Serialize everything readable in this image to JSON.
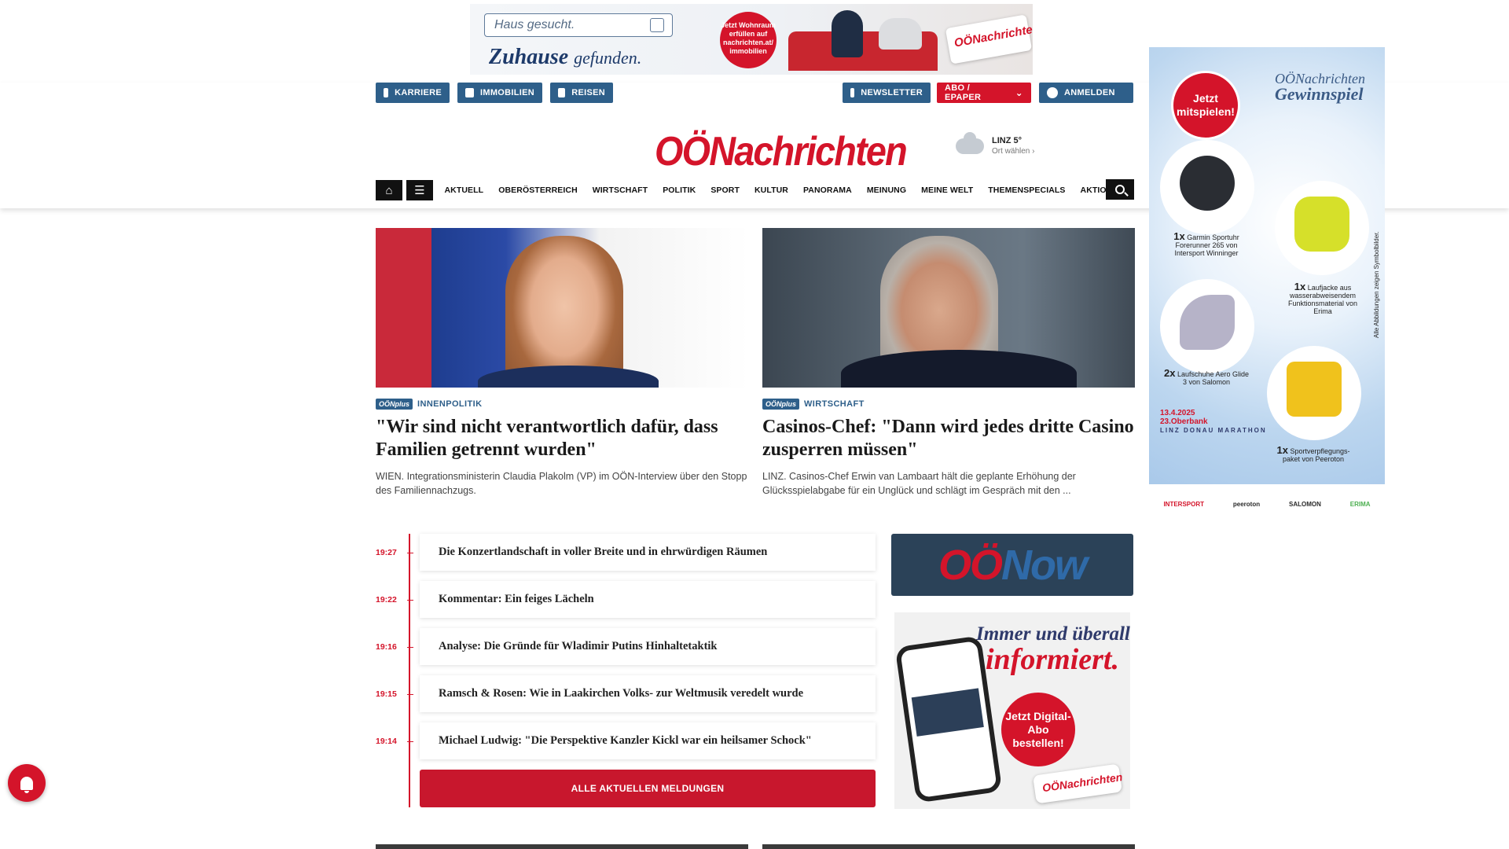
{
  "top_ad": {
    "search_text": "Haus gesucht.",
    "slogan_main": "Zuhause",
    "slogan_tail": "gefunden.",
    "badge_text": "Jetzt Wohnraum erfüllen auf nachrichten.at/ immobilien",
    "paper_text": "OÖNachrichten"
  },
  "utility": {
    "karriere": "KARRIERE",
    "immobilien": "IMMOBILIEN",
    "reisen": "REISEN",
    "newsletter": "NEWSLETTER",
    "abo": "ABO / EPAPER",
    "anmelden": "ANMELDEN"
  },
  "logo": "OÖNachrichten",
  "weather": {
    "city": "LINZ 5°",
    "choose": "Ort wählen"
  },
  "nav": {
    "items": [
      "AKTUELL",
      "OBERÖSTERREICH",
      "WIRTSCHAFT",
      "POLITIK",
      "SPORT",
      "KULTUR",
      "PANORAMA",
      "MEINUNG",
      "MEINE WELT",
      "THEMENSPECIALS",
      "AKTIONEN"
    ]
  },
  "teasers": [
    {
      "badge": "OÖNplus",
      "kicker": "INNENPOLITIK",
      "headline": "\"Wir sind nicht verantwortlich dafür, dass Familien getrennt wurden\"",
      "lead": "WIEN. Integrationsministerin Claudia Plakolm (VP) im OÖN-Interview über den Stopp des Familiennachzugs."
    },
    {
      "badge": "OÖNplus",
      "kicker": "WIRTSCHAFT",
      "headline": "Casinos-Chef: \"Dann wird jedes dritte Casino zusperren müssen\"",
      "lead": "LINZ. Casinos-Chef Erwin van Lambaart hält die geplante Erhöhung der Glücksspielabgabe für ein Unglück und schlägt im Gespräch mit den ..."
    }
  ],
  "ticker": [
    {
      "time": "19:27",
      "title": "Die Konzertlandschaft in voller Breite und in ehrwürdigen Räumen"
    },
    {
      "time": "19:22",
      "title": "Kommentar: Ein feiges Lächeln"
    },
    {
      "time": "19:16",
      "title": "Analyse: Die Gründe für Wladimir Putins Hinhaltetaktik"
    },
    {
      "time": "19:15",
      "title": "Ramsch & Rosen: Wie in Laakirchen Volks- zur Weltmusik veredelt wurde"
    },
    {
      "time": "19:14",
      "title": "Michael Ludwig: \"Die Perspektive Kanzler Kickl war ein heilsamer Schock\""
    }
  ],
  "all_news_label": "ALLE AKTUELLEN MELDUNGEN",
  "oonow": {
    "part1": "OÖ",
    "part2": "Now"
  },
  "abo_ad": {
    "line1": "Immer und überall",
    "line2": "informiert.",
    "circle": "Jetzt Digital-Abo bestellen!",
    "roll": "OÖNachrichten"
  },
  "sky_ad": {
    "jetzt": "Jetzt mitspielen!",
    "title_top": "OÖNachrichten",
    "title_main": "Gewinnspiel",
    "prizes": [
      {
        "count": "1x",
        "text": "Garmin Sportuhr Forerunner 265 von Intersport Winninger"
      },
      {
        "count": "1x",
        "text": "Laufjacke aus wasserabweisendem Funktionsmaterial von Erima"
      },
      {
        "count": "2x",
        "text": "Laufschuhe Aero Glide 3 von Salomon"
      },
      {
        "count": "1x",
        "text": "Sportverpflegungs-paket von Peeroton"
      }
    ],
    "marathon_date": "13.4.2025",
    "marathon_name": "23.Oberbank",
    "marathon_sub": "LINZ DONAU MARATHON",
    "vertical_note": "Alle Abbildungen zeigen Symbolbilder.",
    "sponsors": [
      "INTERSPORT",
      "peeroton",
      "SALOMON",
      "ERIMA"
    ]
  },
  "colors": {
    "brand_red": "#d4142a",
    "brand_blue": "#2e5f8a"
  }
}
